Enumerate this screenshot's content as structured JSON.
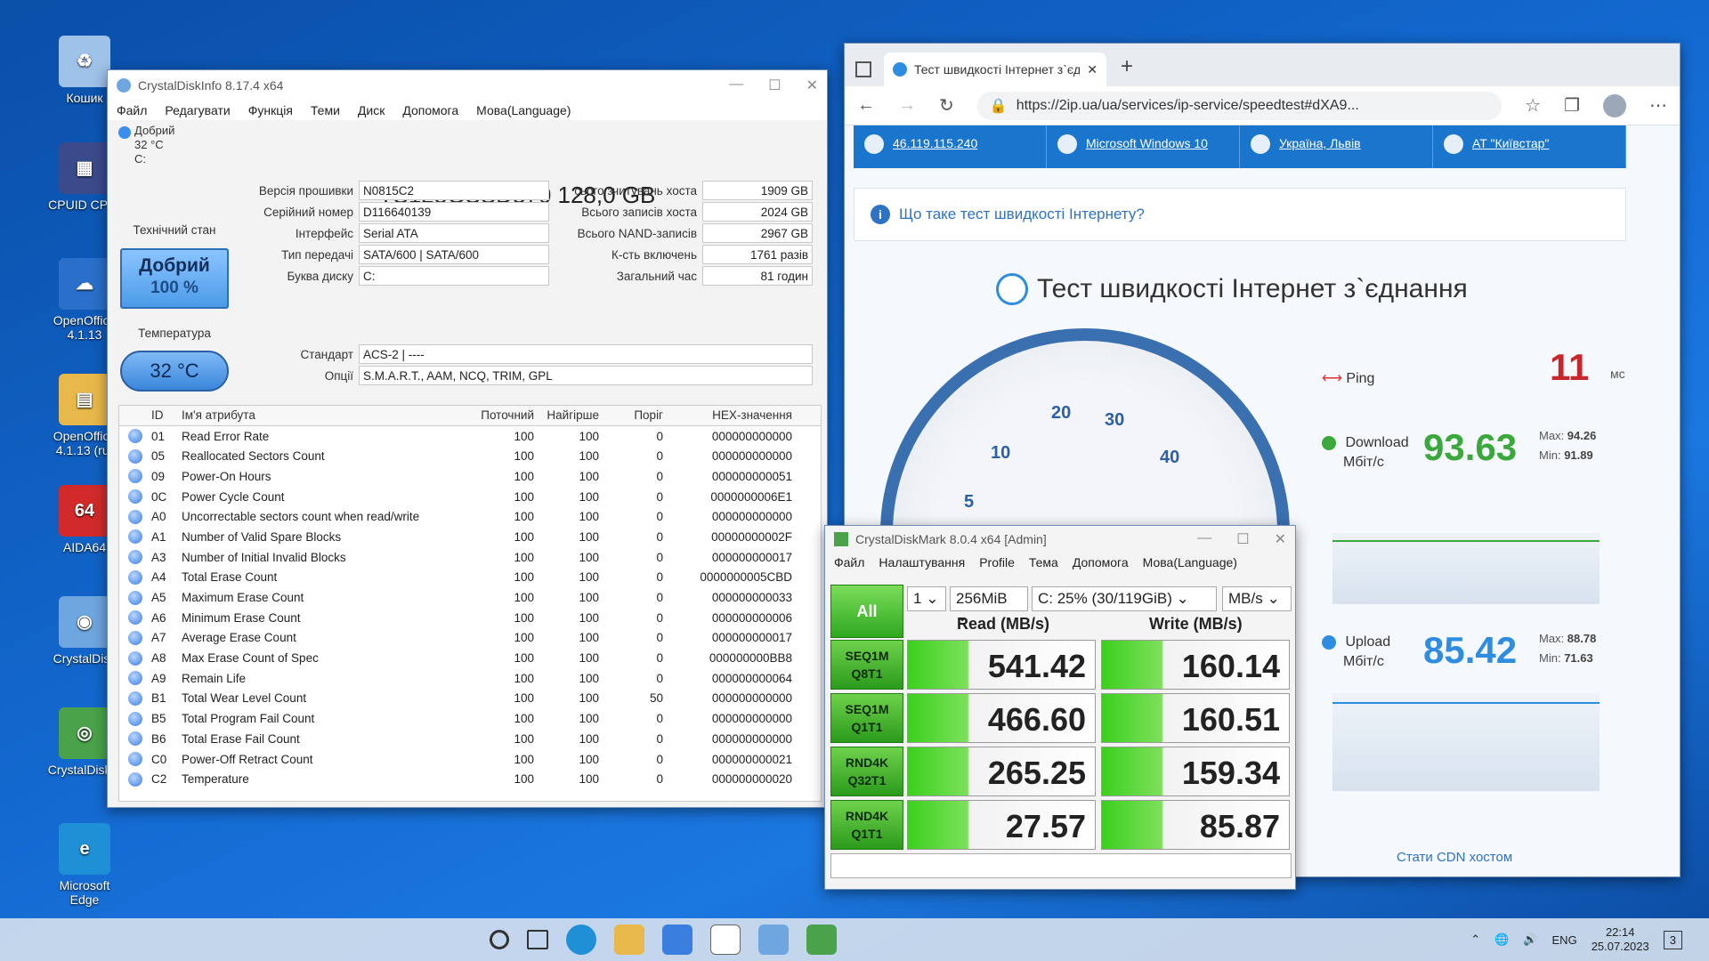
{
  "desktop": {
    "icons": [
      {
        "label": "Кошик",
        "color": "#9fc2e8",
        "glyph": "♻"
      },
      {
        "label": "CPUID CPU-",
        "color": "#3b4a8a",
        "glyph": "▦"
      },
      {
        "label": "OpenOffice 4.1.13",
        "color": "#2a6fc9",
        "glyph": "☁"
      },
      {
        "label": "OpenOffice 4.1.13 (ru)",
        "color": "#e8b84a",
        "glyph": "▤"
      },
      {
        "label": "AIDA64",
        "color": "#d22a2a",
        "glyph": "64"
      },
      {
        "label": "CrystalDisk",
        "color": "#6ea6df",
        "glyph": "◉"
      },
      {
        "label": "CrystalDisk 8",
        "color": "#4aa34a",
        "glyph": "◎"
      },
      {
        "label": "Microsoft Edge",
        "color": "#1f8fd6",
        "glyph": "e"
      }
    ]
  },
  "cdi": {
    "title": "CrystalDiskInfo 8.17.4 x64",
    "menu": [
      "Файл",
      "Редагувати",
      "Функція",
      "Теми",
      "Диск",
      "Допомога",
      "Мова(Language)"
    ],
    "disk_tab": {
      "status": "Добрий",
      "temp": "32 °C",
      "letter": "C:"
    },
    "model": "TS128GSSD370 128,0 GB",
    "health_label": "Технічний стан",
    "health_status": "Добрий",
    "health_percent": "100 %",
    "temp_label": "Температура",
    "temp_value": "32 °C",
    "left_fields": [
      {
        "label": "Версія прошивки",
        "value": "N0815C2"
      },
      {
        "label": "Серійний номер",
        "value": "D116640139"
      },
      {
        "label": "Інтерфейс",
        "value": "Serial ATA"
      },
      {
        "label": "Тип передачі",
        "value": "SATA/600 | SATA/600"
      },
      {
        "label": "Буква диску",
        "value": "C:"
      }
    ],
    "right_fields": [
      {
        "label": "сього зчитувань хоста",
        "value": "1909 GB"
      },
      {
        "label": "Всього записів хоста",
        "value": "2024 GB"
      },
      {
        "label": "Всього NAND-записів",
        "value": "2967 GB"
      },
      {
        "label": "К-сть включень",
        "value": "1761 разів"
      },
      {
        "label": "Загальний час",
        "value": "81 годин"
      }
    ],
    "standard_label": "Стандарт",
    "standard_value": "ACS-2 | ----",
    "options_label": "Опції",
    "options_value": "S.M.A.R.T., AAM, NCQ, TRIM, GPL",
    "smart_headers": {
      "id": "ID",
      "name": "Ім'я атрибута",
      "cur": "Поточний",
      "worst": "Найгірше",
      "thr": "Поріг",
      "raw": "HEX-значення"
    },
    "smart_rows": [
      {
        "id": "01",
        "name": "Read Error Rate",
        "cur": "100",
        "worst": "100",
        "thr": "0",
        "raw": "000000000000"
      },
      {
        "id": "05",
        "name": "Reallocated Sectors Count",
        "cur": "100",
        "worst": "100",
        "thr": "0",
        "raw": "000000000000"
      },
      {
        "id": "09",
        "name": "Power-On Hours",
        "cur": "100",
        "worst": "100",
        "thr": "0",
        "raw": "000000000051"
      },
      {
        "id": "0C",
        "name": "Power Cycle Count",
        "cur": "100",
        "worst": "100",
        "thr": "0",
        "raw": "0000000006E1"
      },
      {
        "id": "A0",
        "name": "Uncorrectable sectors count when read/write",
        "cur": "100",
        "worst": "100",
        "thr": "0",
        "raw": "000000000000"
      },
      {
        "id": "A1",
        "name": "Number of Valid Spare Blocks",
        "cur": "100",
        "worst": "100",
        "thr": "0",
        "raw": "00000000002F"
      },
      {
        "id": "A3",
        "name": "Number of Initial Invalid Blocks",
        "cur": "100",
        "worst": "100",
        "thr": "0",
        "raw": "000000000017"
      },
      {
        "id": "A4",
        "name": "Total Erase Count",
        "cur": "100",
        "worst": "100",
        "thr": "0",
        "raw": "0000000005CBD"
      },
      {
        "id": "A5",
        "name": "Maximum Erase Count",
        "cur": "100",
        "worst": "100",
        "thr": "0",
        "raw": "000000000033"
      },
      {
        "id": "A6",
        "name": "Minimum Erase Count",
        "cur": "100",
        "worst": "100",
        "thr": "0",
        "raw": "000000000006"
      },
      {
        "id": "A7",
        "name": "Average Erase Count",
        "cur": "100",
        "worst": "100",
        "thr": "0",
        "raw": "000000000017"
      },
      {
        "id": "A8",
        "name": "Max Erase Count of Spec",
        "cur": "100",
        "worst": "100",
        "thr": "0",
        "raw": "000000000BB8"
      },
      {
        "id": "A9",
        "name": "Remain Life",
        "cur": "100",
        "worst": "100",
        "thr": "0",
        "raw": "000000000064"
      },
      {
        "id": "B1",
        "name": "Total Wear Level Count",
        "cur": "100",
        "worst": "100",
        "thr": "50",
        "raw": "000000000000"
      },
      {
        "id": "B5",
        "name": "Total Program Fail Count",
        "cur": "100",
        "worst": "100",
        "thr": "0",
        "raw": "000000000000"
      },
      {
        "id": "B6",
        "name": "Total Erase Fail Count",
        "cur": "100",
        "worst": "100",
        "thr": "0",
        "raw": "000000000000"
      },
      {
        "id": "C0",
        "name": "Power-Off Retract Count",
        "cur": "100",
        "worst": "100",
        "thr": "0",
        "raw": "000000000021"
      },
      {
        "id": "C2",
        "name": "Temperature",
        "cur": "100",
        "worst": "100",
        "thr": "0",
        "raw": "000000000020"
      }
    ]
  },
  "browser": {
    "tab_title": "Тест швидкості Інтернет з`єдна",
    "url": "https://2ip.ua/ua/services/ip-service/speedtest#dXA9...",
    "info": [
      "46.119.115.240",
      "Microsoft Windows 10",
      "Україна, Львів",
      "AT \"Київстар\""
    ],
    "faq": "Що таке тест швидкості Інтернету?",
    "heading": "Тест швидкості Інтернет з`єднання",
    "gauge_ticks": [
      "5",
      "10",
      "20",
      "30",
      "40"
    ],
    "ping_label": "Ping",
    "ping_value": "11",
    "ping_unit": "мс",
    "download_label": "Download",
    "download_unit": "Мбіт/с",
    "download_value": "93.63",
    "download_max": "94.26",
    "download_min": "91.89",
    "upload_label": "Upload",
    "upload_unit": "Мбіт/с",
    "upload_value": "85.42",
    "upload_max": "88.78",
    "upload_min": "71.63",
    "max_label": "Max:",
    "min_label": "Min:",
    "cdn_text": "Стати CDN хостом",
    "accent": "#1a76cc",
    "green": "#3aa83a"
  },
  "cdm": {
    "title": "CrystalDiskMark 8.0.4 x64 [Admin]",
    "menu": [
      "Файл",
      "Налаштування",
      "Profile",
      "Тема",
      "Допомога",
      "Мова(Language)"
    ],
    "all": "All",
    "count": "1",
    "size": "256MiB",
    "drive": "C: 25% (30/119GiB)",
    "unit": "MB/s",
    "read_header": "Read (MB/s)",
    "write_header": "Write (MB/s)",
    "tests": [
      {
        "l1": "SEQ1M",
        "l2": "Q8T1",
        "read": "541.42",
        "write": "160.14"
      },
      {
        "l1": "SEQ1M",
        "l2": "Q1T1",
        "read": "466.60",
        "write": "160.51"
      },
      {
        "l1": "RND4K",
        "l2": "Q32T1",
        "read": "265.25",
        "write": "159.34"
      },
      {
        "l1": "RND4K",
        "l2": "Q1T1",
        "read": "27.57",
        "write": "85.87"
      }
    ]
  },
  "taskbar": {
    "lang": "ENG",
    "time": "22:14",
    "date": "25.07.2023",
    "notif": "3"
  }
}
